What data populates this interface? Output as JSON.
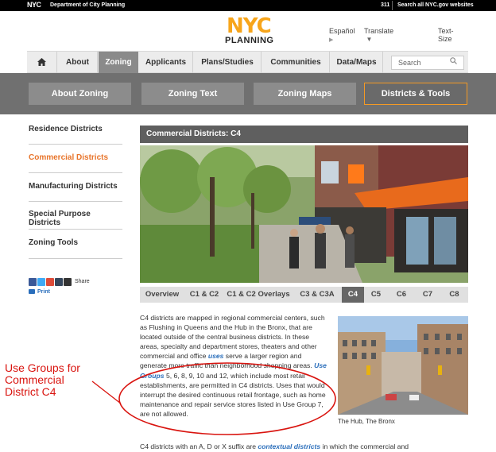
{
  "topbar": {
    "logo": "NYC",
    "department": "Department of City Planning",
    "phone_311": "311",
    "search_all": "Search all NYC.gov websites"
  },
  "header": {
    "brand_top": "NYC",
    "brand_bottom": "PLANNING",
    "espanol": "Español",
    "translate": "Translate",
    "translate_arrow": "▼",
    "text_size": "Text-Size"
  },
  "nav": {
    "home_icon": "home-icon",
    "items": [
      "About",
      "Zoning",
      "Applicants",
      "Plans/Studies",
      "Communities",
      "Data/Maps"
    ],
    "search_placeholder": "Search"
  },
  "subnav": {
    "items": [
      "About Zoning",
      "Zoning Text",
      "Zoning Maps",
      "Districts & Tools"
    ]
  },
  "sidebar": {
    "items": [
      "Residence Districts",
      "Commercial Districts",
      "Manufacturing Districts",
      "Special Purpose Districts",
      "Zoning Tools"
    ],
    "share_label": "Share",
    "print_label": "Print"
  },
  "content": {
    "title": "Commercial Districts: C4",
    "tabs": [
      "Overview",
      "C1 & C2",
      "C1 & C2 Overlays",
      "C3 & C3A",
      "C4",
      "C5",
      "C6",
      "C7",
      "C8"
    ],
    "para_a": "C4 districts are mapped in regional commercial centers, such as Flushing in Queens and the Hub in the Bronx, that are located outside of the central business districts. In these areas, specialty and department stores, theaters and other commercial and office ",
    "link_uses": "uses",
    "para_b": " serve a larger region and generate more traffic than neighborhood shopping areas. ",
    "link_use_groups": "Use Groups",
    "para_c": " 5, 6, 8, 9, 10 and 12, which include most retail establishments, are permitted in C4 districts. Uses that would interrupt the desired continuous retail frontage, such as home maintenance and repair service stores listed in Use Group 7, are not allowed.",
    "caption": "The Hub, The Bronx",
    "bottom_a": "C4 districts with an A, D or X suffix are ",
    "bottom_link": "contextual districts",
    "bottom_b": " in which the commercial and"
  },
  "annotation": {
    "lines": [
      "Use Groups for",
      "Commercial",
      "District C4"
    ]
  },
  "colors": {
    "accent_orange": "#e8742a",
    "link_blue": "#2a6ebb",
    "annotation_red": "#d9140f"
  }
}
